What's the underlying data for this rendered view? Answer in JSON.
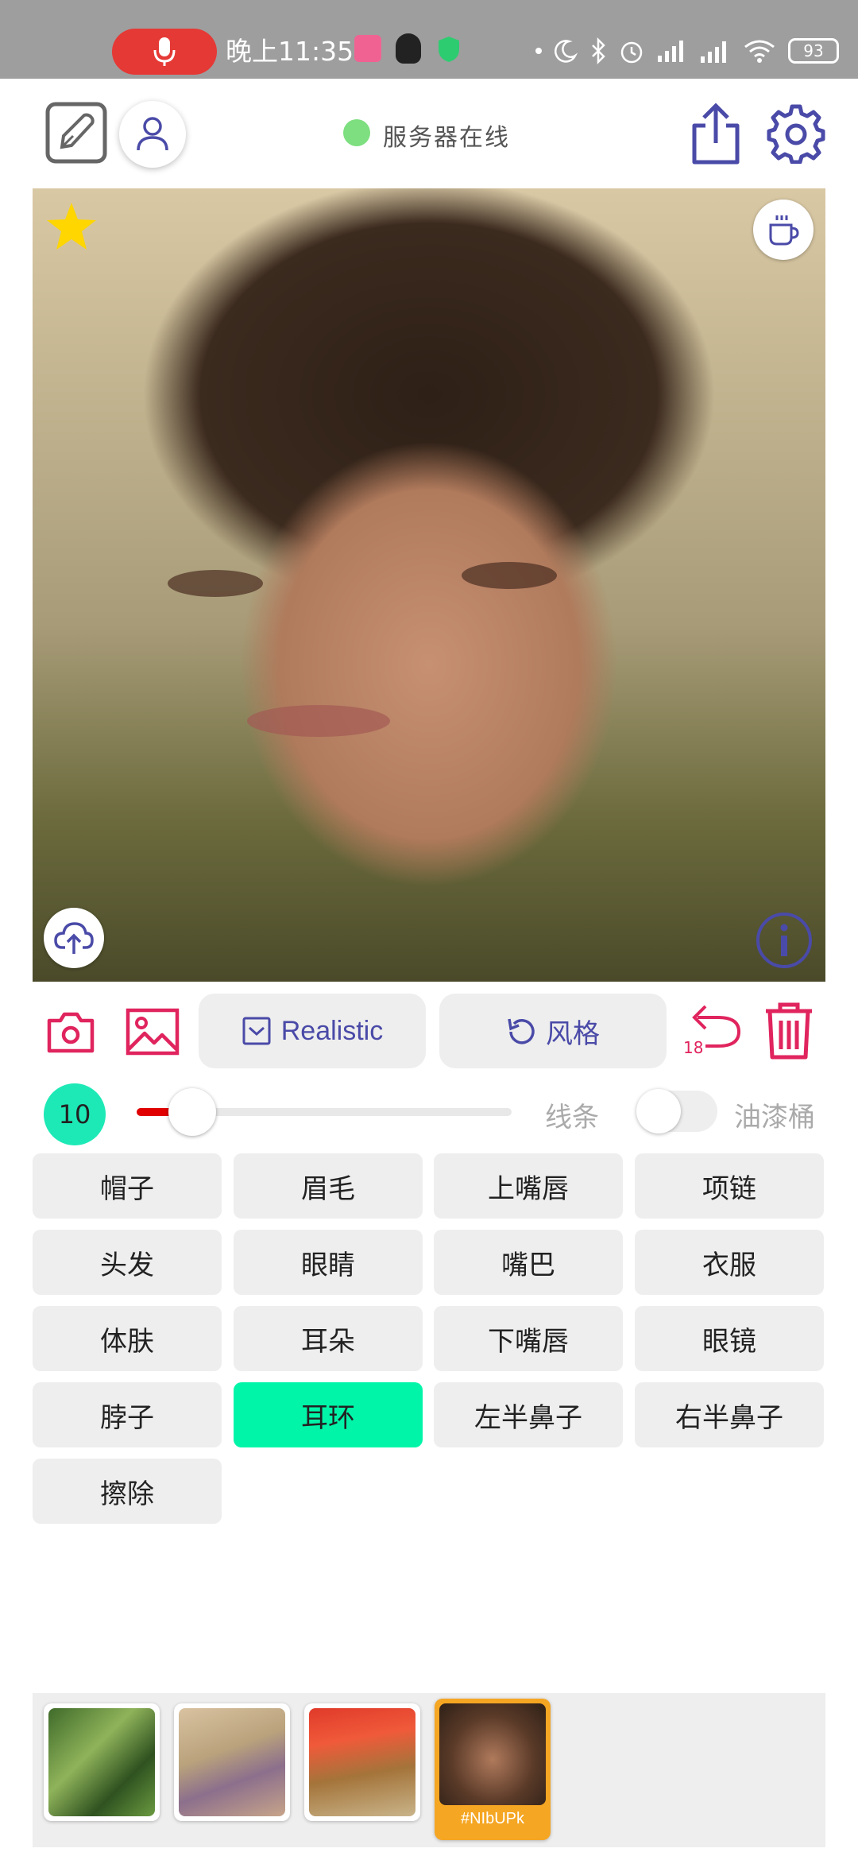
{
  "status_bar": {
    "time": "晚上11:35",
    "battery": "93",
    "icons": [
      "mic-icon",
      "app-icon",
      "qq-icon",
      "shield-icon",
      "dot-icon",
      "moon-icon",
      "bluetooth-icon",
      "alarm-icon",
      "signal-icon",
      "hd-signal-icon",
      "wifi-icon",
      "battery-icon"
    ]
  },
  "header": {
    "server_status": "服务器在线",
    "server_color": "#7ddf7f"
  },
  "canvas": {
    "icons": [
      "star-icon",
      "coffee-icon",
      "upload-cloud-icon",
      "info-icon"
    ]
  },
  "toolbar": {
    "realistic_label": "Realistic",
    "style_label": "风格",
    "undo_count": "18"
  },
  "brush": {
    "size": "10",
    "line_label": "线条",
    "bucket_label": "油漆桶",
    "slider_value_fraction": 0.1
  },
  "parts": [
    {
      "label": "帽子",
      "selected": false
    },
    {
      "label": "眉毛",
      "selected": false
    },
    {
      "label": "上嘴唇",
      "selected": false
    },
    {
      "label": "项链",
      "selected": false
    },
    {
      "label": "头发",
      "selected": false
    },
    {
      "label": "眼睛",
      "selected": false
    },
    {
      "label": "嘴巴",
      "selected": false
    },
    {
      "label": "衣服",
      "selected": false
    },
    {
      "label": "体肤",
      "selected": false
    },
    {
      "label": "耳朵",
      "selected": false
    },
    {
      "label": "下嘴唇",
      "selected": false
    },
    {
      "label": "眼镜",
      "selected": false
    },
    {
      "label": "脖子",
      "selected": false
    },
    {
      "label": "耳环",
      "selected": true
    },
    {
      "label": "左半鼻子",
      "selected": false
    },
    {
      "label": "右半鼻子",
      "selected": false
    },
    {
      "label": "擦除",
      "selected": false
    }
  ],
  "history": {
    "active_tag": "#NIbUPk"
  },
  "colors": {
    "accent_purple": "#4a4aa8",
    "accent_pink": "#e0245e",
    "selected_green": "#00f5a8",
    "size_circle": "#1de9b6"
  }
}
